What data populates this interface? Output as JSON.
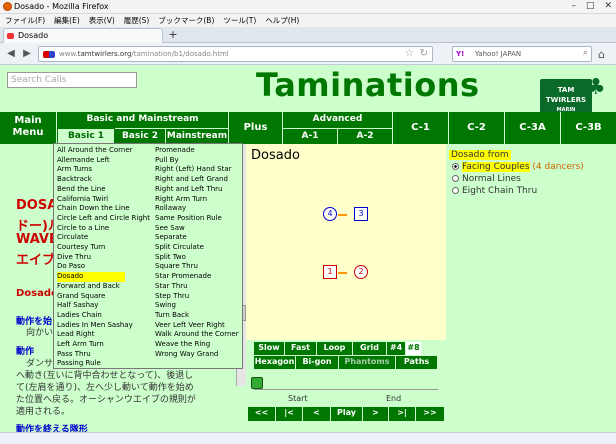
{
  "window": {
    "title": "Dosado - Mozilla Firefox",
    "buttons": [
      "–",
      "□",
      "✕"
    ]
  },
  "menubar": [
    "ファイル(F)",
    "編集(E)",
    "表示(V)",
    "履歴(S)",
    "ブックマーク(B)",
    "ツール(T)",
    "ヘルプ(H)"
  ],
  "tab": {
    "label": "Dosado",
    "new_tab": "+"
  },
  "nav": {
    "url_grey": "www.",
    "url_main": "tamtwirlers.org",
    "url_rest": "/tamination/b1/dosado.html",
    "search_engine": "Y!",
    "search_placeholder": "Yahoo! JAPAN"
  },
  "page": {
    "search_placeholder": "Search Calls",
    "brand_title": "Taminations",
    "logo_text": [
      "TAM",
      "TWIRLERS",
      "MARIN"
    ],
    "nav": {
      "main_menu": "Main Menu",
      "basic_mainstream": "Basic and Mainstream",
      "basic1": "Basic 1",
      "basic2": "Basic 2",
      "mainstream": "Mainstream",
      "plus": "Plus",
      "advanced": "Advanced",
      "a1": "A-1",
      "a2": "A-2",
      "c1": "C-1",
      "c2": "C-2",
      "c3a": "C-3A",
      "c3b": "C-3B"
    },
    "left": {
      "jp_lines": [
        "DOSA",
        "ドー)ル",
        "WAVE",
        "エイブ"
      ],
      "dosado_label": "Dosado",
      "sub1": "動作を始",
      "sub1_text": "向かい",
      "sub2": "動作",
      "text_lines": [
        "ダンサ",
        "へ動き(互いに背中合わせとなって)、後退し",
        "て(左肩を通り)、左へ少し動いて動作を始め",
        "た位置へ戻る。オーシャンウエイブの規則が",
        "適用される。"
      ],
      "sub3": "動作を終える隊形"
    },
    "dropdown": {
      "col1": [
        "All Around the Corner",
        "Allemande Left",
        "Arm Turns",
        "Backtrack",
        "Bend the Line",
        "California Twirl",
        "Chain Down the Line",
        "Circle Left and Circle Right",
        "Circle to a Line",
        "Circulate",
        "Courtesy Turn",
        "Dive Thru",
        "Do Paso",
        "Dosado",
        "Forward and Back",
        "Grand Square",
        "Half Sashay",
        "Ladies Chain",
        "Ladies In Men Sashay",
        "Lead Right",
        "Left Arm Turn",
        "Pass Thru",
        "Passing Rule"
      ],
      "col2": [
        "Promenade",
        "Pull By",
        "Right (Left) Hand Star",
        "Right and Left Grand",
        "Right and Left Thru",
        "Right Arm Turn",
        "Rollaway",
        "Same Position Rule",
        "See Saw",
        "Separate",
        "Split Circulate",
        "Split Two",
        "Square Thru",
        "Star Promenade",
        "Star Thru",
        "Step Thru",
        "Swing",
        "Turn Back",
        "Veer Left Veer Right",
        "Walk Around the Corner",
        "Weave the Ring",
        "Wrong Way Grand"
      ],
      "highlighted": "Dosado"
    },
    "animation": {
      "title": "Dosado",
      "dancers": [
        {
          "label": "4",
          "type": "girl",
          "color": "#0000cc"
        },
        {
          "label": "3",
          "type": "boy",
          "color": "#0000cc"
        },
        {
          "label": "1",
          "type": "boy",
          "color": "#cc0000"
        },
        {
          "label": "2",
          "type": "girl",
          "color": "#cc0000"
        }
      ]
    },
    "controls": {
      "row1": [
        "Slow",
        "Fast",
        "Loop",
        "Grid",
        "#4",
        "#8"
      ],
      "row2": [
        "Hexagon",
        "Bi-gon",
        "Phantoms",
        "Paths"
      ],
      "start": "Start",
      "end": "End",
      "playback": [
        "<<",
        "|<",
        "<",
        "Play",
        ">",
        ">|",
        ">>"
      ],
      "slider_position": 0
    },
    "formations": {
      "heading": "Dosado from",
      "options": [
        {
          "label": "Facing Couples",
          "count": "(4 dancers)",
          "selected": true
        },
        {
          "label": "Normal Lines",
          "selected": false
        },
        {
          "label": "Eight Chain Thru",
          "selected": false
        }
      ]
    }
  }
}
